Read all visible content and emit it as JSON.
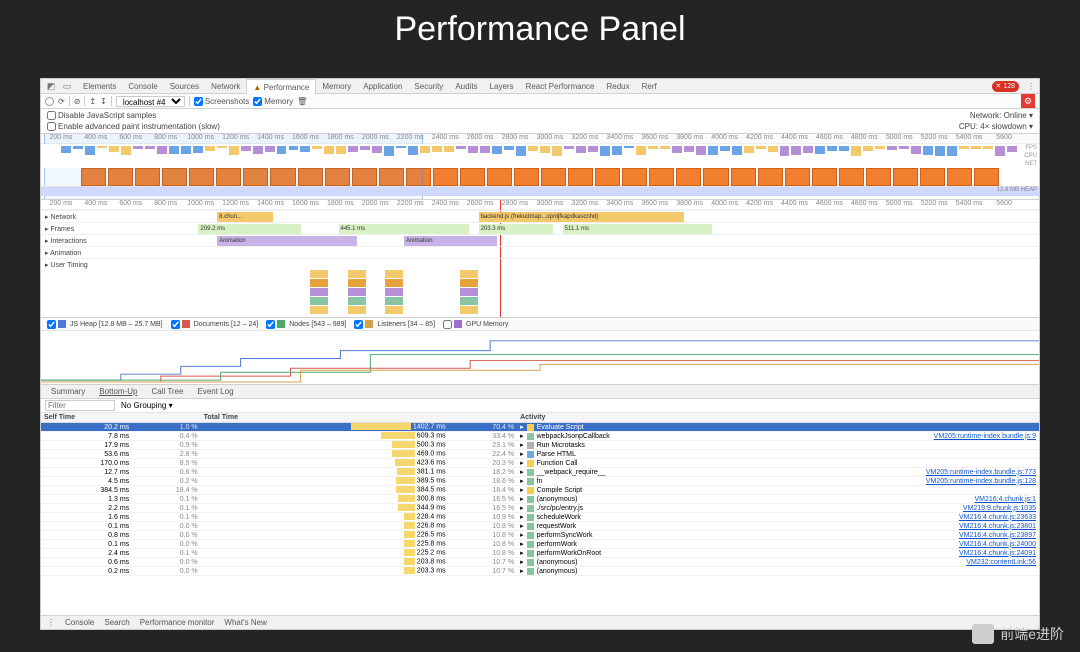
{
  "title": "Performance Panel",
  "top_tabs": [
    "Elements",
    "Console",
    "Sources",
    "Network",
    "Performance",
    "Memory",
    "Application",
    "Security",
    "Audits",
    "Layers",
    "React Performance",
    "Redux",
    "Rerf"
  ],
  "active_tab_index": 4,
  "error_count": "128",
  "toolbar": {
    "target": "localhost #4",
    "screenshots": "Screenshots",
    "memory": "Memory"
  },
  "options": {
    "disable_js": "Disable JavaScript samples",
    "advanced_paint": "Enable advanced paint instrumentation (slow)",
    "network_label": "Network:",
    "network_value": "Online",
    "cpu_label": "CPU:",
    "cpu_value": "4× slowdown"
  },
  "time_ticks": [
    "200 ms",
    "400 ms",
    "600 ms",
    "800 ms",
    "1000 ms",
    "1200 ms",
    "1400 ms",
    "1600 ms",
    "1800 ms",
    "2000 ms",
    "2200 ms",
    "2400 ms",
    "2600 ms",
    "2800 ms",
    "3000 ms",
    "3200 ms",
    "3400 ms",
    "3600 ms",
    "3800 ms",
    "4000 ms",
    "4200 ms",
    "4400 ms",
    "4600 ms",
    "4800 ms",
    "5000 ms",
    "5200 ms",
    "5400 ms",
    "5600"
  ],
  "overview_lanes": [
    "FPS",
    "CPU",
    "NET",
    "HEAP"
  ],
  "heap_size": "12.8 MB",
  "track_labels": {
    "network": "Network",
    "frames": "Frames",
    "interactions": "Interactions",
    "animation": "Animation",
    "usertiming": "User Timing"
  },
  "network_items": [
    "8.chun...",
    "backend.js (frekudmap...op/djfkapdkascnhd)"
  ],
  "frame_segments": [
    "209.2 ms",
    "445.1 ms",
    "203.3 ms",
    "511.1 ms"
  ],
  "anim_label": "Animation",
  "mem_legend": {
    "heap": "JS Heap [12.8 MB – 25.7 MB]",
    "documents": "Documents [12 – 24]",
    "nodes": "Nodes [543 – 989]",
    "listeners": "Listeners [34 – 85]",
    "gpu": "GPU Memory"
  },
  "bottom_tabs": [
    "Summary",
    "Bottom-Up",
    "Call Tree",
    "Event Log"
  ],
  "bottom_active": 1,
  "filter_placeholder": "Filter",
  "grouping": "No Grouping",
  "columns": [
    "Self Time",
    "",
    "Total Time",
    "",
    "Activity"
  ],
  "rows": [
    {
      "self": "20.2 ms",
      "spct": "1.0 %",
      "total": "1402.7 ms",
      "tpct": "70.4 %",
      "act": "Evaluate Script",
      "c": "#f5d050",
      "link": "",
      "sel": true
    },
    {
      "self": "7.8 ms",
      "spct": "0.4 %",
      "total": "609.3 ms",
      "tpct": "33.4 %",
      "act": "webpackJsonpCallback",
      "c": "#89c4a0",
      "link": "VM205:runtime-index.bundle.js:9"
    },
    {
      "self": "17.9 ms",
      "spct": "0.9 %",
      "total": "500.3 ms",
      "tpct": "23.1 %",
      "act": "Run Microtasks",
      "c": "#b0b0b0",
      "link": ""
    },
    {
      "self": "53.6 ms",
      "spct": "2.8 %",
      "total": "469.0 ms",
      "tpct": "22.4 %",
      "act": "Parse HTML",
      "c": "#6fa8dc",
      "link": ""
    },
    {
      "self": "170.0 ms",
      "spct": "8.5 %",
      "total": "423.6 ms",
      "tpct": "20.3 %",
      "act": "Function Call",
      "c": "#f5d050",
      "link": ""
    },
    {
      "self": "12.7 ms",
      "spct": "0.6 %",
      "total": "381.1 ms",
      "tpct": "18.2 %",
      "act": "__webpack_require__",
      "c": "#89c4a0",
      "link": "VM205:runtime-index.bundle.js:773"
    },
    {
      "self": "4.5 ms",
      "spct": "0.2 %",
      "total": "389.5 ms",
      "tpct": "18.6 %",
      "act": "fn",
      "c": "#89c4a0",
      "link": "VM205:runtime-index.bundle.js:128"
    },
    {
      "self": "384.5 ms",
      "spct": "18.4 %",
      "total": "384.5 ms",
      "tpct": "18.4 %",
      "act": "Compile Script",
      "c": "#f5d050",
      "link": ""
    },
    {
      "self": "1.3 ms",
      "spct": "0.1 %",
      "total": "300.8 ms",
      "tpct": "16.5 %",
      "act": "(anonymous)",
      "c": "#89c4a0",
      "link": "VM216:4.chunk.js:1"
    },
    {
      "self": "2.2 ms",
      "spct": "0.1 %",
      "total": "344.9 ms",
      "tpct": "16.5 %",
      "act": "./src/pc/entry.js",
      "c": "#89c4a0",
      "link": "VM219:9.chunk.js:1035"
    },
    {
      "self": "1.6 ms",
      "spct": "0.1 %",
      "total": "228.4 ms",
      "tpct": "10.9 %",
      "act": "scheduleWork",
      "c": "#89c4a0",
      "link": "VM216:4.chunk.js:23633"
    },
    {
      "self": "0.1 ms",
      "spct": "0.0 %",
      "total": "226.8 ms",
      "tpct": "10.8 %",
      "act": "requestWork",
      "c": "#89c4a0",
      "link": "VM216:4.chunk.js:23801"
    },
    {
      "self": "0.8 ms",
      "spct": "0.0 %",
      "total": "226.5 ms",
      "tpct": "10.8 %",
      "act": "performSyncWork",
      "c": "#89c4a0",
      "link": "VM216:4.chunk.js:23897"
    },
    {
      "self": "0.1 ms",
      "spct": "0.0 %",
      "total": "225.8 ms",
      "tpct": "10.8 %",
      "act": "performWork",
      "c": "#89c4a0",
      "link": "VM216:4.chunk.js:24000"
    },
    {
      "self": "2.4 ms",
      "spct": "0.1 %",
      "total": "225.2 ms",
      "tpct": "10.8 %",
      "act": "performWorkOnRoot",
      "c": "#89c4a0",
      "link": "VM216:4.chunk.js:24091"
    },
    {
      "self": "0.6 ms",
      "spct": "0.0 %",
      "total": "203.8 ms",
      "tpct": "10.7 %",
      "act": "(anonymous)",
      "c": "#89c4a0",
      "link": "VM232:contentLink:56"
    },
    {
      "self": "0.2 ms",
      "spct": "0.0 %",
      "total": "203.3 ms",
      "tpct": "10.7 %",
      "act": "(anonymous)",
      "c": "#89c4a0",
      "link": ""
    }
  ],
  "drawer_tabs": [
    "Console",
    "Search",
    "Performance monitor",
    "What's New"
  ],
  "watermark": "前端e进阶"
}
